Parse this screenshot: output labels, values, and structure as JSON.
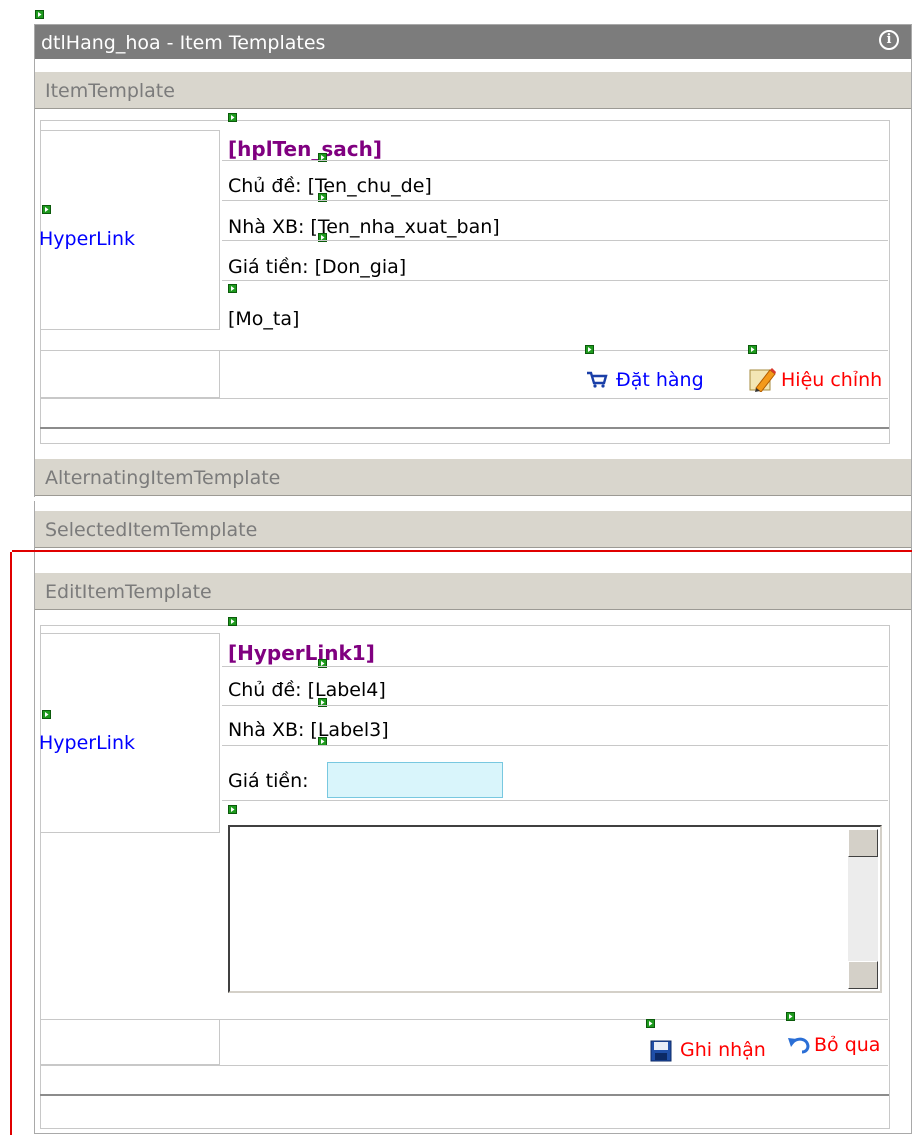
{
  "panel": {
    "title": "dtlHang_hoa - Item Templates",
    "info_icon": "info-icon"
  },
  "sections": {
    "item_template": "ItemTemplate",
    "alternating": "AlternatingItemTemplate",
    "selected": "SelectedItemTemplate",
    "edit": "EditItemTemplate"
  },
  "item": {
    "image_link": "HyperLink",
    "title": "[hplTen_sach]",
    "topic": "Chủ đề: [Ten_chu_de]",
    "publisher": "Nhà XB: [Ten_nha_xuat_ban]",
    "price": "Giá tiền: [Don_gia]",
    "description": "[Mo_ta]",
    "order_label": "Đặt hàng",
    "edit_label": "Hiệu chỉnh"
  },
  "edit": {
    "image_link": "HyperLink",
    "title": "[HyperLink1]",
    "topic": "Chủ đề: [Label4]",
    "publisher": "Nhà XB: [Label3]",
    "price_label": "Giá tiền:",
    "price_value": "",
    "description_value": "",
    "save_label": "Ghi nhận",
    "cancel_label": "Bỏ qua"
  },
  "colors": {
    "title_bar": "#7c7c7c",
    "section_bar": "#d9d6cd",
    "link_blue": "#0000ff",
    "link_red": "#ff0000",
    "title_purple": "#800080",
    "highlight_red": "#e00000"
  },
  "icons": [
    "smart-tag-glyph",
    "cart-icon",
    "pencil-edit-icon",
    "save-disk-icon",
    "undo-arrow-icon",
    "info-icon"
  ]
}
